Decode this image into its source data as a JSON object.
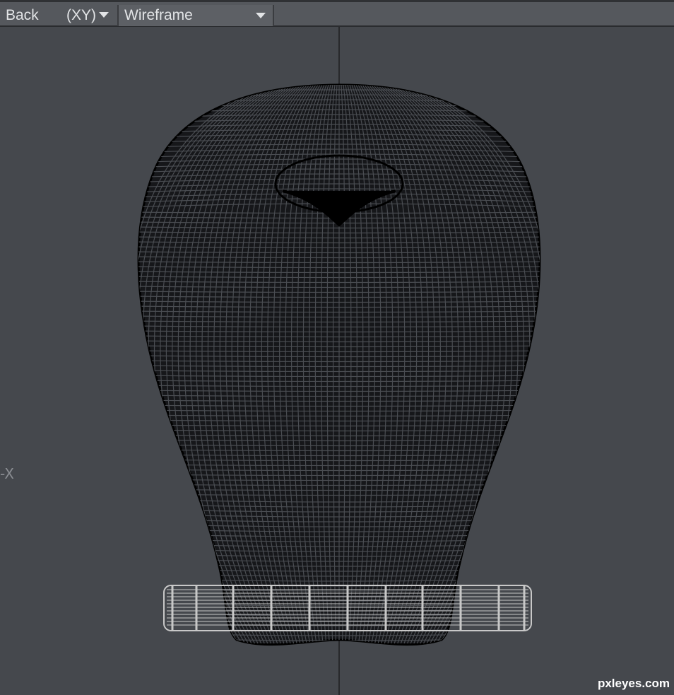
{
  "toolbar": {
    "view": "Back",
    "projection": "(XY)",
    "render_mode": "Wireframe"
  },
  "viewport": {
    "axis_marker": "-X",
    "watermark": "pxleyes.com"
  },
  "colors": {
    "background": "#45484d",
    "wire": "#000000",
    "ring": "#c8c8c8"
  },
  "icons": [
    "chevron-down-icon"
  ]
}
